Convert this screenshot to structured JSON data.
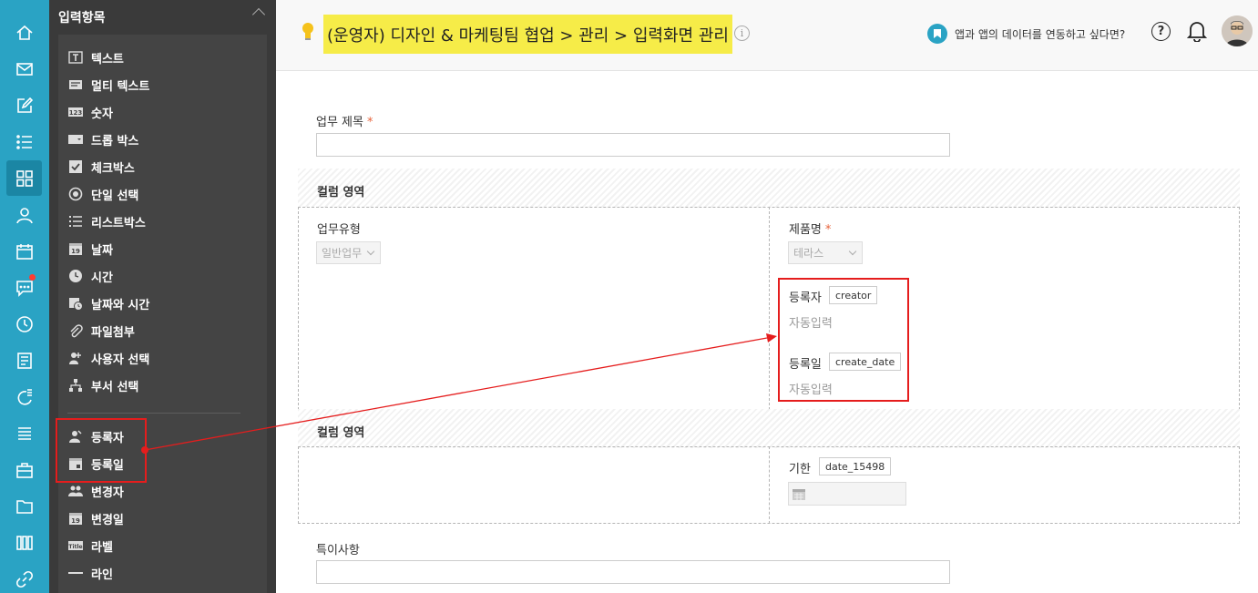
{
  "rail": {
    "items": [
      {
        "name": "home-icon"
      },
      {
        "name": "mail-icon"
      },
      {
        "name": "edit-icon"
      },
      {
        "name": "task-list-icon"
      },
      {
        "name": "apps-grid-icon",
        "active": true
      },
      {
        "name": "user-icon"
      },
      {
        "name": "calendar-icon"
      },
      {
        "name": "chat-icon",
        "badge": true
      },
      {
        "name": "clock-icon"
      },
      {
        "name": "board-icon"
      },
      {
        "name": "report-icon"
      },
      {
        "name": "list-stack-icon"
      },
      {
        "name": "briefcase-icon"
      },
      {
        "name": "folder-icon"
      },
      {
        "name": "archive-icon"
      },
      {
        "name": "link-icon"
      }
    ]
  },
  "panel": {
    "title": "입력항목",
    "items": [
      {
        "label": "텍스트",
        "icon": "text-field-icon"
      },
      {
        "label": "멀티 텍스트",
        "icon": "multi-text-icon"
      },
      {
        "label": "숫자",
        "icon": "number-icon"
      },
      {
        "label": "드롭 박스",
        "icon": "dropbox-icon"
      },
      {
        "label": "체크박스",
        "icon": "checkbox-icon"
      },
      {
        "label": "단일 선택",
        "icon": "radio-icon"
      },
      {
        "label": "리스트박스",
        "icon": "listbox-icon"
      },
      {
        "label": "날짜",
        "icon": "date-icon"
      },
      {
        "label": "시간",
        "icon": "time-icon"
      },
      {
        "label": "날짜와 시간",
        "icon": "datetime-icon"
      },
      {
        "label": "파일첨부",
        "icon": "attachment-icon"
      },
      {
        "label": "사용자 선택",
        "icon": "user-select-icon"
      },
      {
        "label": "부서 선택",
        "icon": "department-icon"
      }
    ],
    "system_items": [
      {
        "label": "등록자",
        "icon": "creator-icon"
      },
      {
        "label": "등록일",
        "icon": "created-date-icon"
      },
      {
        "label": "변경자",
        "icon": "modifier-icon"
      },
      {
        "label": "변경일",
        "icon": "modified-date-icon"
      },
      {
        "label": "라벨",
        "icon": "label-icon"
      },
      {
        "label": "라인",
        "icon": "line-icon"
      }
    ]
  },
  "header": {
    "breadcrumb": "(운영자) 디자인 & 마케팅팀 협업 > 관리 > 입력화면 관리",
    "integration_link": "앱과 앱의 데이터를 연동하고 싶다면?",
    "help": "?",
    "info": "i"
  },
  "form": {
    "title_label": "업무 제목",
    "required_mark": "*",
    "column_area_1": "컬럼 영역",
    "work_type_label": "업무유형",
    "work_type_value": "일반업무",
    "product_label": "제품명",
    "product_value": "테라스",
    "creator_label": "등록자",
    "creator_tag": "creator",
    "creator_auto": "자동입력",
    "created_label": "등록일",
    "created_tag": "create_date",
    "created_auto": "자동입력",
    "column_area_2": "컬럼 영역",
    "due_label": "기한",
    "due_tag": "date_15498",
    "notes_label": "특이사항"
  },
  "colors": {
    "rail": "#2aa3c4",
    "panel": "#3a3a3a",
    "highlight": "#f6ec48",
    "annotation": "#e51d1d",
    "required": "#e7643c"
  }
}
